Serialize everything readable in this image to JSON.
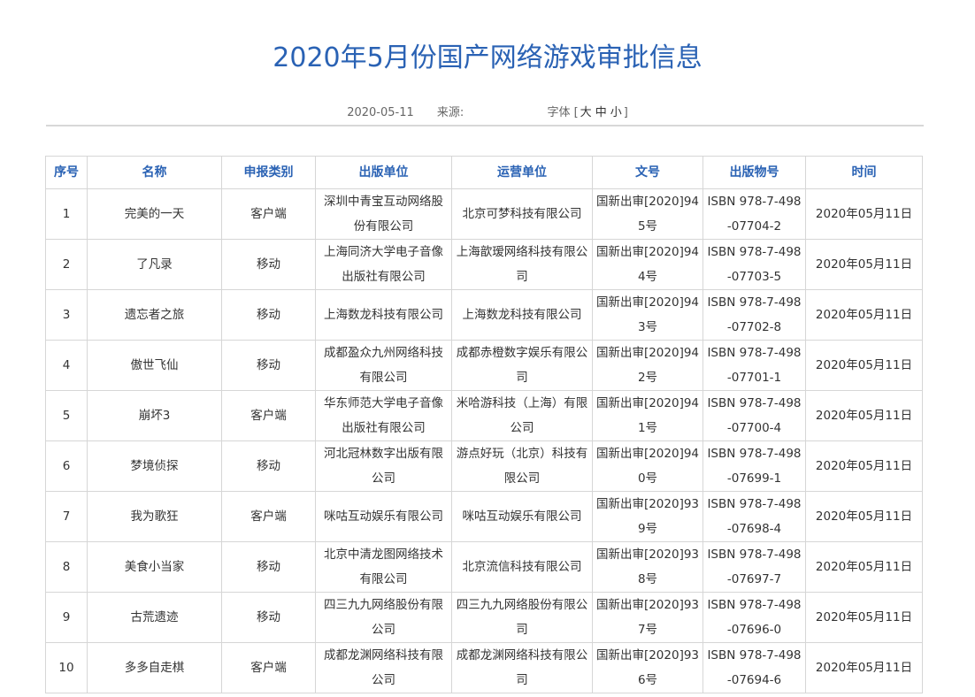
{
  "article": {
    "title": "2020年5月份国产网络游戏审批信息",
    "date": "2020-05-11",
    "source_label": "来源:",
    "font_label": "字体",
    "font_sizes": [
      "大",
      "中",
      "小"
    ]
  },
  "table": {
    "headers": [
      "序号",
      "名称",
      "申报类别",
      "出版单位",
      "运营单位",
      "文号",
      "出版物号",
      "时间"
    ],
    "rows": [
      [
        "1",
        "完美的一天",
        "客户端",
        "深圳中青宝互动网络股份有限公司",
        "北京可梦科技有限公司",
        "国新出审[2020]945号",
        "ISBN 978-7-498-07704-2",
        "2020年05月11日"
      ],
      [
        "2",
        "了凡录",
        "移动",
        "上海同济大学电子音像出版社有限公司",
        "上海歆瑷网络科技有限公司",
        "国新出审[2020]944号",
        "ISBN 978-7-498-07703-5",
        "2020年05月11日"
      ],
      [
        "3",
        "遗忘者之旅",
        "移动",
        "上海数龙科技有限公司",
        "上海数龙科技有限公司",
        "国新出审[2020]943号",
        "ISBN 978-7-498-07702-8",
        "2020年05月11日"
      ],
      [
        "4",
        "傲世飞仙",
        "移动",
        "成都盈众九州网络科技有限公司",
        "成都赤橙数字娱乐有限公司",
        "国新出审[2020]942号",
        "ISBN 978-7-498-07701-1",
        "2020年05月11日"
      ],
      [
        "5",
        "崩坏3",
        "客户端",
        "华东师范大学电子音像出版社有限公司",
        "米哈游科技（上海）有限公司",
        "国新出审[2020]941号",
        "ISBN 978-7-498-07700-4",
        "2020年05月11日"
      ],
      [
        "6",
        "梦境侦探",
        "移动",
        "河北冠林数字出版有限公司",
        "游点好玩（北京）科技有限公司",
        "国新出审[2020]940号",
        "ISBN 978-7-498-07699-1",
        "2020年05月11日"
      ],
      [
        "7",
        "我为歌狂",
        "客户端",
        "咪咕互动娱乐有限公司",
        "咪咕互动娱乐有限公司",
        "国新出审[2020]939号",
        "ISBN 978-7-498-07698-4",
        "2020年05月11日"
      ],
      [
        "8",
        "美食小当家",
        "移动",
        "北京中清龙图网络技术有限公司",
        "北京流信科技有限公司",
        "国新出审[2020]938号",
        "ISBN 978-7-498-07697-7",
        "2020年05月11日"
      ],
      [
        "9",
        "古荒遗迹",
        "移动",
        "四三九九网络股份有限公司",
        "四三九九网络股份有限公司",
        "国新出审[2020]937号",
        "ISBN 978-7-498-07696-0",
        "2020年05月11日"
      ],
      [
        "10",
        "多多自走棋",
        "客户端",
        "成都龙渊网络科技有限公司",
        "成都龙渊网络科技有限公司",
        "国新出审[2020]936号",
        "ISBN 978-7-498-07694-6",
        "2020年05月11日"
      ]
    ]
  }
}
